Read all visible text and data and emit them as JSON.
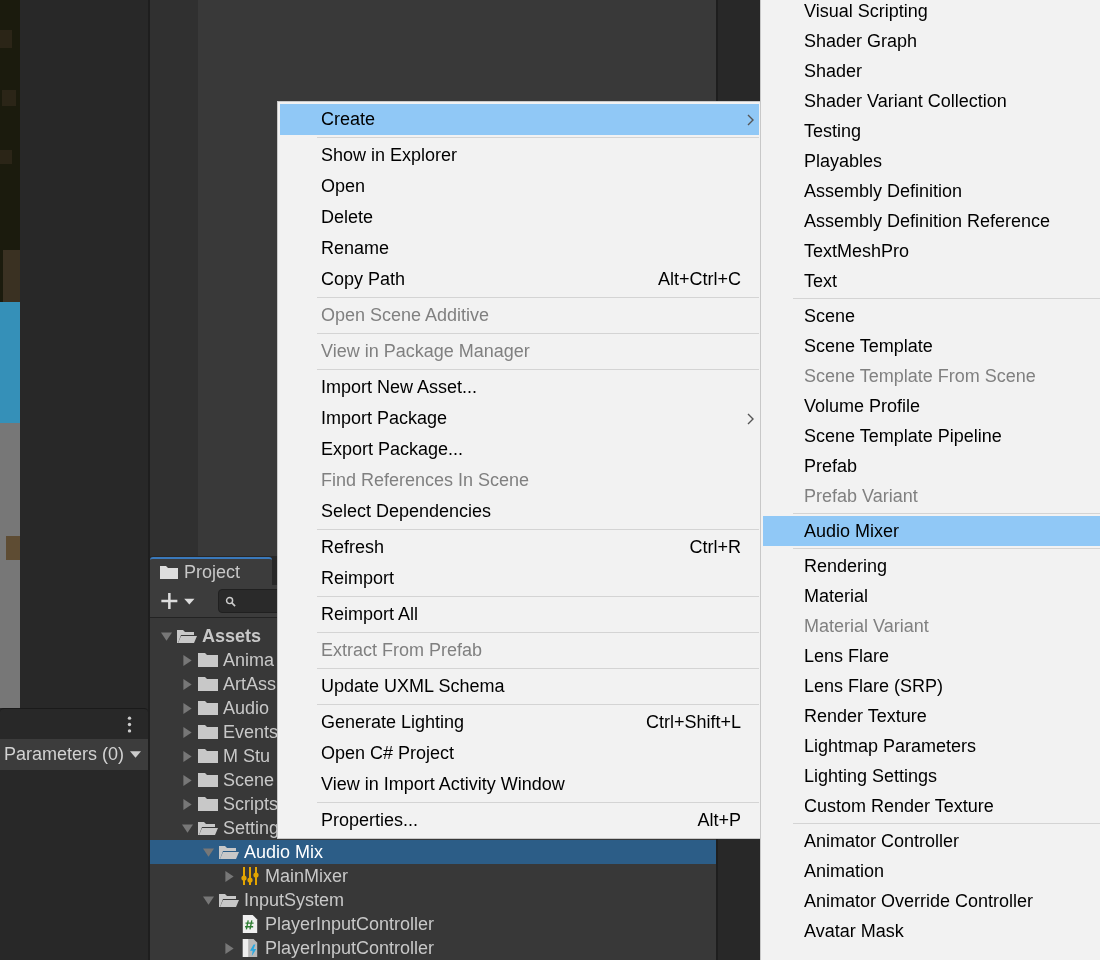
{
  "mixer_panel": {
    "parameters_dropdown": "Parameters (0)"
  },
  "project_panel": {
    "tab": {
      "label": "Project",
      "selected": true
    },
    "tree": [
      {
        "label": "Assets",
        "kind": "folder",
        "expanded": true,
        "selected": false,
        "children": [
          {
            "label": "Anima",
            "kind": "folder",
            "expanded": false,
            "selected": false
          },
          {
            "label": "ArtAss",
            "kind": "folder",
            "expanded": false,
            "selected": false
          },
          {
            "label": "Audio",
            "kind": "folder",
            "expanded": false,
            "selected": false
          },
          {
            "label": "Events",
            "kind": "folder",
            "expanded": false,
            "selected": false
          },
          {
            "label": "M Stu",
            "kind": "folder",
            "expanded": false,
            "selected": false
          },
          {
            "label": "Scene",
            "kind": "folder",
            "expanded": false,
            "selected": false
          },
          {
            "label": "Scripts",
            "kind": "folder",
            "expanded": false,
            "selected": false
          },
          {
            "label": "Setting",
            "kind": "folder",
            "expanded": true,
            "selected": false,
            "children": [
              {
                "label": "Audio Mix",
                "kind": "folder",
                "expanded": true,
                "selected": true,
                "children": [
                  {
                    "label": "MainMixer",
                    "kind": "mixer",
                    "expanded": false,
                    "selected": false
                  }
                ]
              },
              {
                "label": "InputSystem",
                "kind": "folder",
                "expanded": true,
                "selected": false,
                "children": [
                  {
                    "label": "PlayerInputController",
                    "kind": "script",
                    "selected": false
                  },
                  {
                    "label": "PlayerInputController",
                    "kind": "input-actions",
                    "expanded": false,
                    "selected": false
                  }
                ]
              }
            ]
          }
        ]
      }
    ]
  },
  "context_menu": {
    "groups": [
      {
        "items": [
          {
            "label": "Create",
            "selected": true,
            "disabled": false,
            "submenu": true
          }
        ]
      },
      {
        "items": [
          {
            "label": "Show in Explorer",
            "selected": false,
            "disabled": false
          },
          {
            "label": "Open",
            "selected": false,
            "disabled": false
          },
          {
            "label": "Delete",
            "selected": false,
            "disabled": false
          },
          {
            "label": "Rename",
            "selected": false,
            "disabled": false
          },
          {
            "label": "Copy Path",
            "shortcut": "Alt+Ctrl+C",
            "selected": false,
            "disabled": false
          }
        ]
      },
      {
        "items": [
          {
            "label": "Open Scene Additive",
            "selected": false,
            "disabled": true
          }
        ]
      },
      {
        "items": [
          {
            "label": "View in Package Manager",
            "selected": false,
            "disabled": true
          }
        ]
      },
      {
        "items": [
          {
            "label": "Import New Asset...",
            "selected": false,
            "disabled": false
          },
          {
            "label": "Import Package",
            "selected": false,
            "disabled": false,
            "submenu": true
          },
          {
            "label": "Export Package...",
            "selected": false,
            "disabled": false
          },
          {
            "label": "Find References In Scene",
            "selected": false,
            "disabled": true
          },
          {
            "label": "Select Dependencies",
            "selected": false,
            "disabled": false
          }
        ]
      },
      {
        "items": [
          {
            "label": "Refresh",
            "shortcut": "Ctrl+R",
            "selected": false,
            "disabled": false
          },
          {
            "label": "Reimport",
            "selected": false,
            "disabled": false
          }
        ]
      },
      {
        "items": [
          {
            "label": "Reimport All",
            "selected": false,
            "disabled": false
          }
        ]
      },
      {
        "items": [
          {
            "label": "Extract From Prefab",
            "selected": false,
            "disabled": true
          }
        ]
      },
      {
        "items": [
          {
            "label": "Update UXML Schema",
            "selected": false,
            "disabled": false
          }
        ]
      },
      {
        "items": [
          {
            "label": "Generate Lighting",
            "shortcut": "Ctrl+Shift+L",
            "selected": false,
            "disabled": false
          },
          {
            "label": "Open C# Project",
            "selected": false,
            "disabled": false
          },
          {
            "label": "View in Import Activity Window",
            "selected": false,
            "disabled": false
          }
        ]
      },
      {
        "items": [
          {
            "label": "Properties...",
            "shortcut": "Alt+P",
            "selected": false,
            "disabled": false
          }
        ]
      }
    ]
  },
  "create_submenu": {
    "groups": [
      {
        "items": [
          {
            "label": "Visual Scripting",
            "selected": false,
            "disabled": false
          },
          {
            "label": "Shader Graph",
            "selected": false,
            "disabled": false
          },
          {
            "label": "Shader",
            "selected": false,
            "disabled": false
          },
          {
            "label": "Shader Variant Collection",
            "selected": false,
            "disabled": false
          },
          {
            "label": "Testing",
            "selected": false,
            "disabled": false
          },
          {
            "label": "Playables",
            "selected": false,
            "disabled": false
          },
          {
            "label": "Assembly Definition",
            "selected": false,
            "disabled": false
          },
          {
            "label": "Assembly Definition Reference",
            "selected": false,
            "disabled": false
          },
          {
            "label": "TextMeshPro",
            "selected": false,
            "disabled": false
          },
          {
            "label": "Text",
            "selected": false,
            "disabled": false
          }
        ]
      },
      {
        "items": [
          {
            "label": "Scene",
            "selected": false,
            "disabled": false
          },
          {
            "label": "Scene Template",
            "selected": false,
            "disabled": false
          },
          {
            "label": "Scene Template From Scene",
            "selected": false,
            "disabled": true
          },
          {
            "label": "Volume Profile",
            "selected": false,
            "disabled": false
          },
          {
            "label": "Scene Template Pipeline",
            "selected": false,
            "disabled": false
          },
          {
            "label": "Prefab",
            "selected": false,
            "disabled": false
          },
          {
            "label": "Prefab Variant",
            "selected": false,
            "disabled": true
          }
        ]
      },
      {
        "items": [
          {
            "label": "Audio Mixer",
            "selected": true,
            "disabled": false
          }
        ]
      },
      {
        "items": [
          {
            "label": "Rendering",
            "selected": false,
            "disabled": false
          },
          {
            "label": "Material",
            "selected": false,
            "disabled": false
          },
          {
            "label": "Material Variant",
            "selected": false,
            "disabled": true
          },
          {
            "label": "Lens Flare",
            "selected": false,
            "disabled": false
          },
          {
            "label": "Lens Flare (SRP)",
            "selected": false,
            "disabled": false
          },
          {
            "label": "Render Texture",
            "selected": false,
            "disabled": false
          },
          {
            "label": "Lightmap Parameters",
            "selected": false,
            "disabled": false
          },
          {
            "label": "Lighting Settings",
            "selected": false,
            "disabled": false
          },
          {
            "label": "Custom Render Texture",
            "selected": false,
            "disabled": false
          }
        ]
      },
      {
        "items": [
          {
            "label": "Animator Controller",
            "selected": false,
            "disabled": false
          },
          {
            "label": "Animation",
            "selected": false,
            "disabled": false
          },
          {
            "label": "Animator Override Controller",
            "selected": false,
            "disabled": false
          },
          {
            "label": "Avatar Mask",
            "selected": false,
            "disabled": false
          }
        ]
      }
    ]
  }
}
